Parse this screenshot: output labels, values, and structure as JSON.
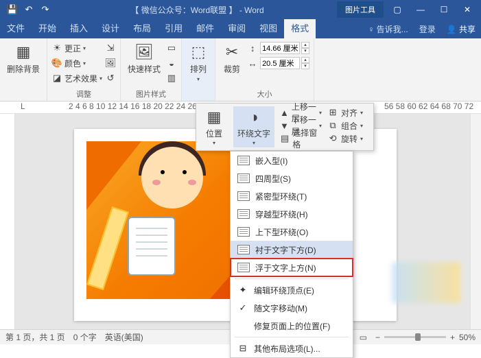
{
  "titlebar": {
    "doc_title": "【 微信公众号：Word联盟 】 - Word",
    "context_tab": "图片工具"
  },
  "tabs": {
    "file": "文件",
    "home": "开始",
    "insert": "插入",
    "design": "设计",
    "layout": "布局",
    "references": "引用",
    "mailings": "邮件",
    "review": "审阅",
    "view": "视图",
    "format": "格式",
    "tellme": "♀ 告诉我...",
    "login": "登录",
    "share": "共享"
  },
  "ribbon": {
    "remove_bg": "删除背景",
    "adjust": {
      "label": "调整",
      "correction": "更正",
      "color": "颜色",
      "effects": "艺术效果"
    },
    "styles": {
      "label": "图片样式",
      "quick": "快速样式"
    },
    "arrange": {
      "label": "排列",
      "btn": "排列"
    },
    "size": {
      "label": "大小",
      "crop": "裁剪",
      "height": "14.66 厘米",
      "width": "20.5 厘米"
    }
  },
  "arrange_popup": {
    "position": "位置",
    "wrap": "环绕文字",
    "bring_forward": "上移一层",
    "send_backward": "下移一层",
    "selection": "选择窗格",
    "align": "对齐",
    "group": "组合",
    "rotate": "旋转"
  },
  "wrap_menu": {
    "inline": "嵌入型(I)",
    "square": "四周型(S)",
    "tight": "紧密型环绕(T)",
    "through": "穿越型环绕(H)",
    "topbottom": "上下型环绕(O)",
    "behind": "衬于文字下方(D)",
    "front": "浮于文字上方(N)",
    "edit": "编辑环绕顶点(E)",
    "move_with": "随文字移动(M)",
    "fix_pos": "修复页面上的位置(F)",
    "more": "其他布局选项(L)..."
  },
  "statusbar": {
    "page": "第 1 页，共 1 页",
    "words": "0 个字",
    "lang": "英语(美国)",
    "zoom": "50%"
  }
}
